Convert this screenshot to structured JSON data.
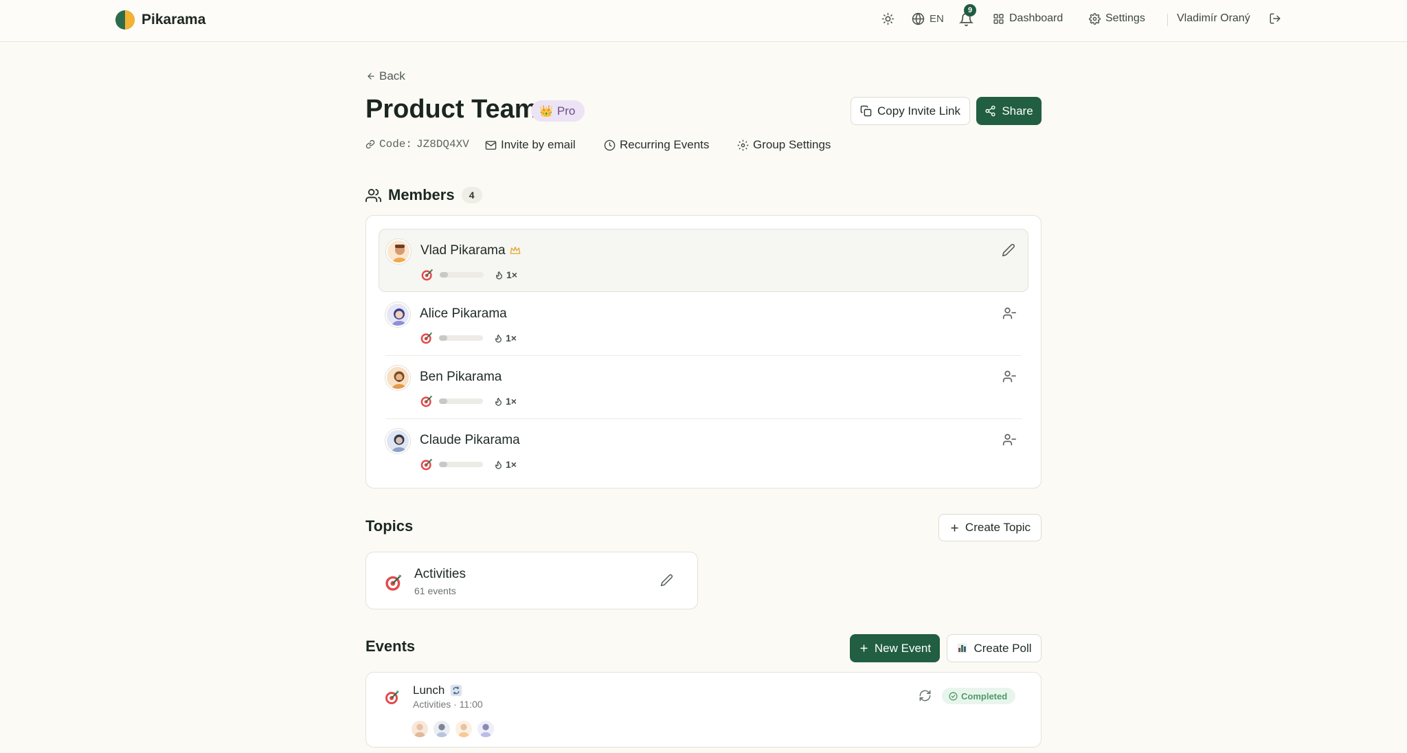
{
  "app": {
    "name": "Pikarama"
  },
  "nav": {
    "language": "EN",
    "notifications_count": "9",
    "dashboard": "Dashboard",
    "settings": "Settings",
    "user": "Vladimír Oraný"
  },
  "page": {
    "back": "Back",
    "title": "Product Team",
    "plan_badge": "Pro",
    "copy_invite": "Copy Invite Link",
    "share": "Share",
    "code_label": "Code:",
    "code": "JZ8DQ4XV",
    "invite_email": "Invite by email",
    "recurring": "Recurring Events",
    "group_settings": "Group Settings"
  },
  "members": {
    "title": "Members",
    "count": "4",
    "items": [
      {
        "name": "Vlad Pikarama",
        "owner": true,
        "streak": "1×",
        "progress": 0.18,
        "color": "#f0a84e"
      },
      {
        "name": "Alice Pikarama",
        "owner": false,
        "streak": "1×",
        "progress": 0.18,
        "color": "#8e8fd8"
      },
      {
        "name": "Ben Pikarama",
        "owner": false,
        "streak": "1×",
        "progress": 0.18,
        "color": "#e39a4a"
      },
      {
        "name": "Claude Pikarama",
        "owner": false,
        "streak": "1×",
        "progress": 0.18,
        "color": "#8aa0c8"
      }
    ]
  },
  "topics": {
    "title": "Topics",
    "create": "Create Topic",
    "items": [
      {
        "name": "Activities",
        "count": "61 events"
      }
    ]
  },
  "events": {
    "title": "Events",
    "new_event": "New Event",
    "create_poll": "Create Poll",
    "items": [
      {
        "name": "Lunch",
        "meta": "Activities · 11:00",
        "status": "Completed"
      }
    ]
  },
  "colors": {
    "primary": "#215e42",
    "background": "#fbfaf5",
    "pro_badge_bg": "#ece3f5",
    "completed": "#4f9a69"
  }
}
